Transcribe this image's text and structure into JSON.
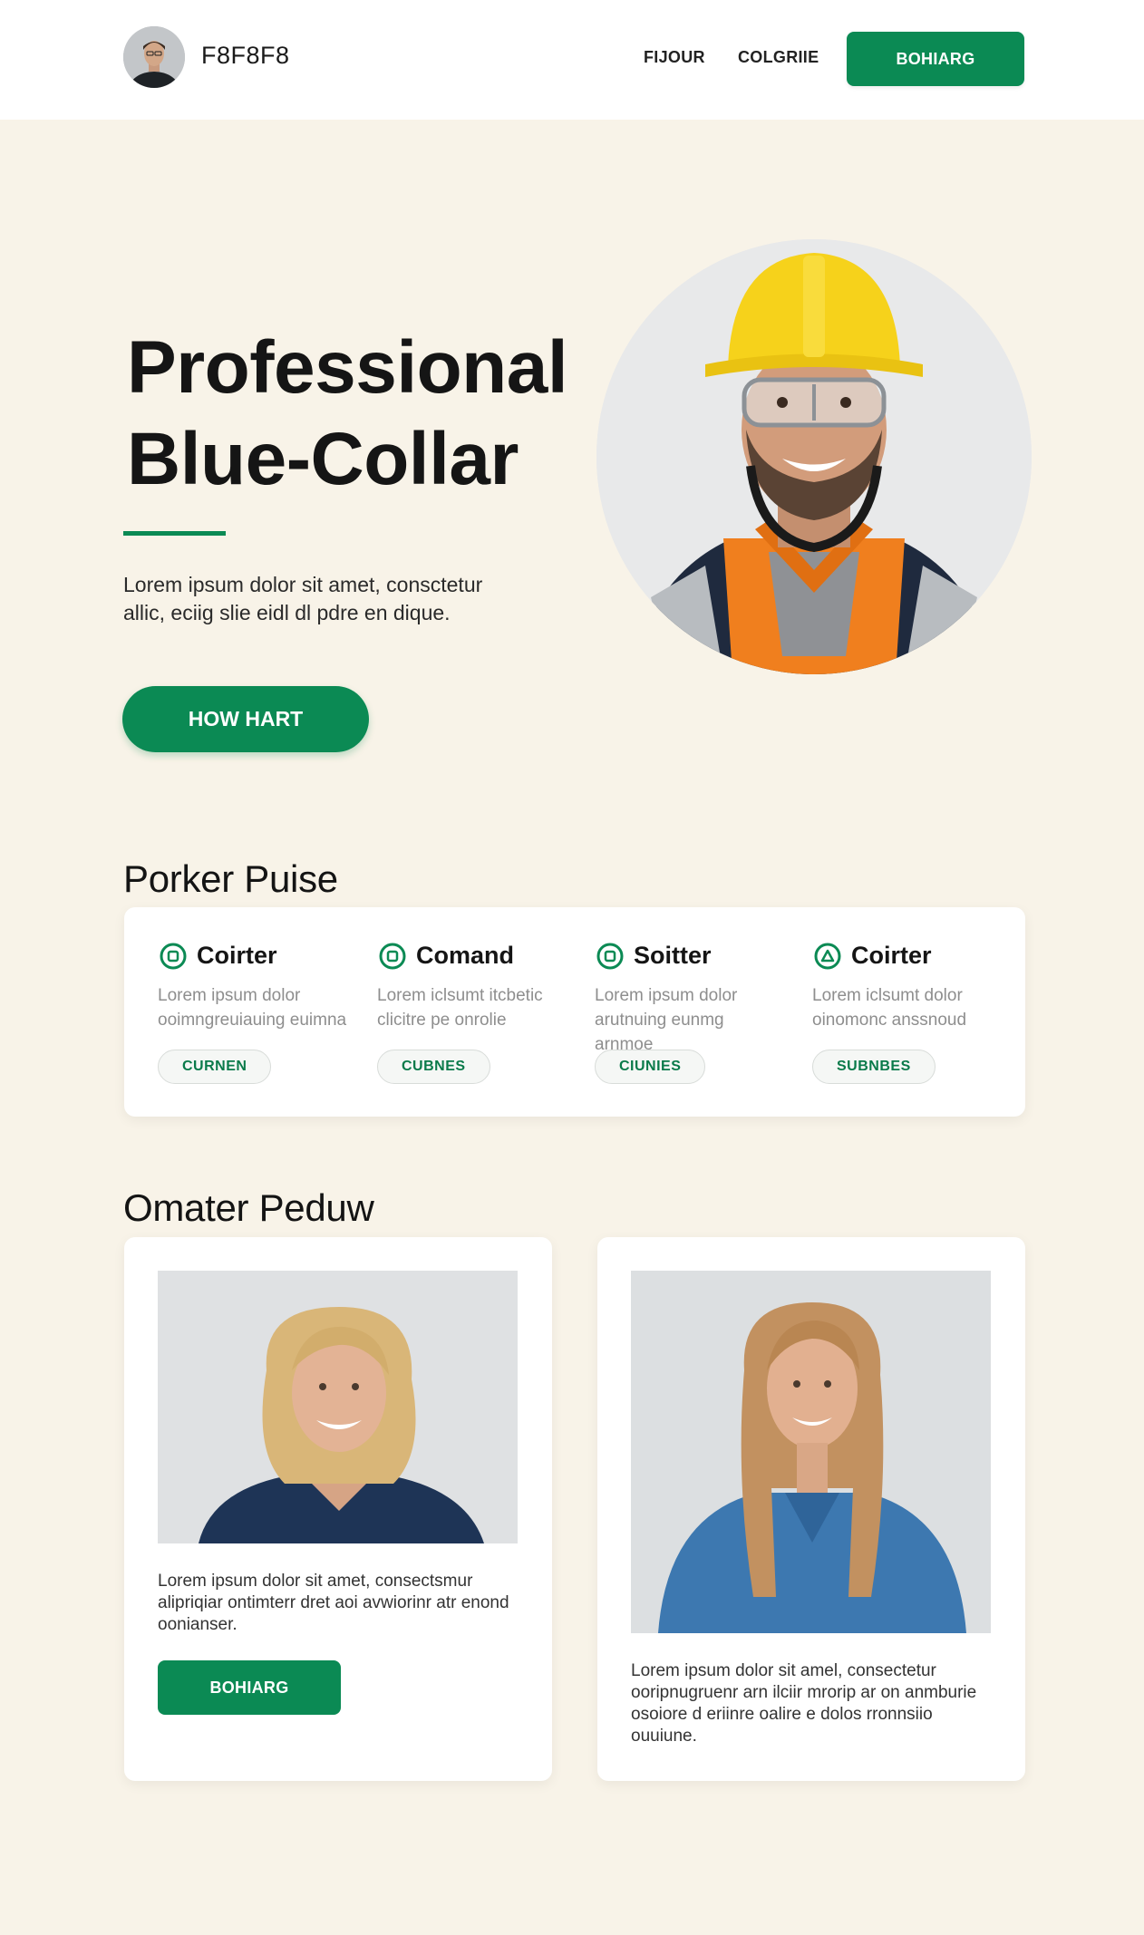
{
  "header": {
    "brand_name": "F8F8F8",
    "nav": [
      "FIJOUR",
      "COLGRIIE"
    ],
    "cta_label": "BOHIARG"
  },
  "hero": {
    "title_line1": "Professional",
    "title_line2": "Blue-Collar",
    "text_line1": "Lorem ipsum dolor sit amet, consctetur",
    "text_line2": "allic, eciig slie eidl dl pdre en dique.",
    "cta_label": "HOW HART"
  },
  "services": {
    "section_title": "Porker Puise",
    "items": [
      {
        "title": "Coirter",
        "icon": "square-circle-icon",
        "desc_line1": "Lorem ipsum dolor",
        "desc_line2": "ooimngreuiauing euimna",
        "chip": "CURNEN"
      },
      {
        "title": "Comand",
        "icon": "square-circle-icon",
        "desc_line1": "Lorem iclsumt itcbetic",
        "desc_line2": "clicitre pe onrolie",
        "chip": "CUBNES"
      },
      {
        "title": "Soitter",
        "icon": "square-circle-icon",
        "desc_line1": "Lorem ipsum dolor",
        "desc_line2": "arutnuing eunmg arnmoe",
        "chip": "CIUNIES"
      },
      {
        "title": "Coirter",
        "icon": "triangle-circle-icon",
        "desc_line1": "Lorem iclsumt dolor",
        "desc_line2": "oinomonc anssnoud",
        "chip": "SUBNBES"
      }
    ]
  },
  "team": {
    "section_title": "Omater Peduw",
    "cards": [
      {
        "text_line1": "Lorem ipsum dolor sit amet, consectsmur",
        "text_line2": "alipriqiar ontimterr dret aoi avwiorinr atr enond",
        "text_line3": "oonianser.",
        "cta_label": "BOHIARG"
      },
      {
        "text_line1": "Lorem ipsum dolor sit amel, consectetur",
        "text_line2": "ooripnugruenr arn ilciir mrorip ar on anmburie",
        "text_line3": "osoiore d eriinre oalire e dolos rronnsiio",
        "text_line4": "ouuiune."
      }
    ]
  },
  "colors": {
    "accent": "#0b8a54",
    "page_bg": "#f8f3e8",
    "header_bg": "#ffffff"
  }
}
